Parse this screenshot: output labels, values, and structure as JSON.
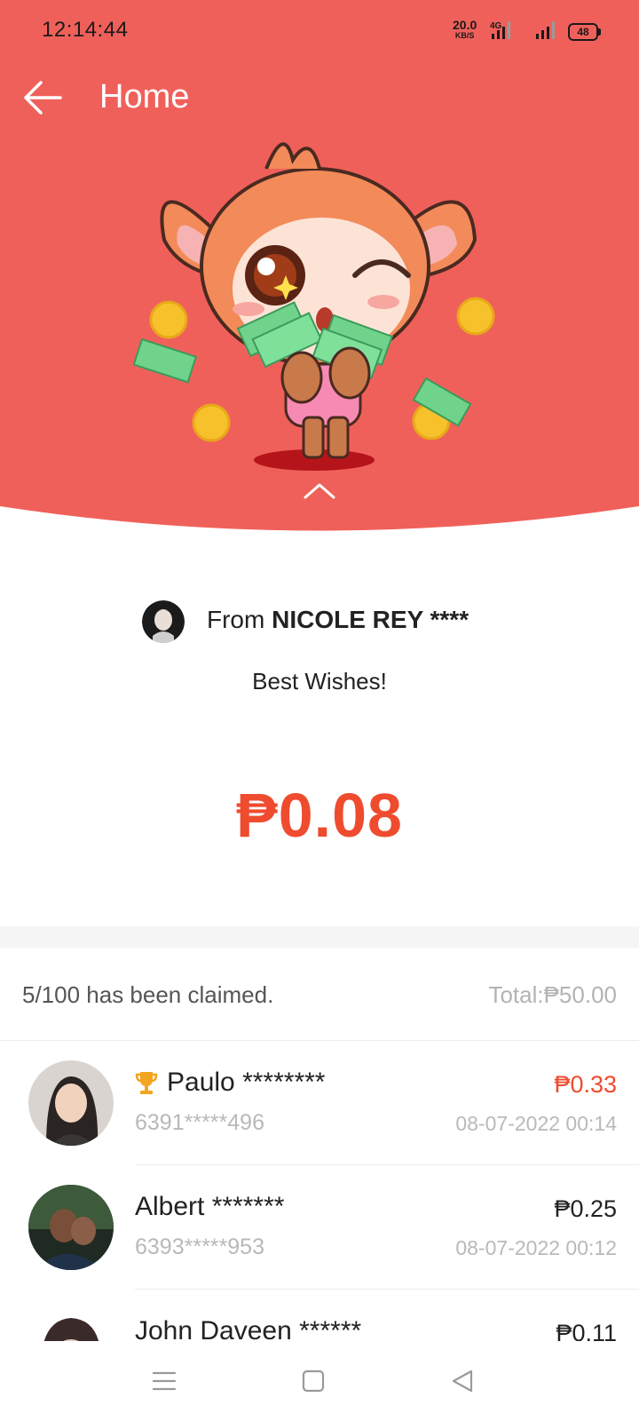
{
  "status_bar": {
    "time": "12:14:44",
    "net_speed_value": "20.0",
    "net_speed_unit": "KB/S",
    "network_type": "4G",
    "battery": "48"
  },
  "nav": {
    "title": "Home"
  },
  "sender": {
    "from_prefix": "From",
    "name": "NICOLE REY ****",
    "message": "Best Wishes!"
  },
  "amount": "₱0.08",
  "claim": {
    "status": "5/100 has been claimed.",
    "total": "Total:₱50.00"
  },
  "claims_list": [
    {
      "name": "Paulo ********",
      "phone": "6391*****496",
      "amount": "₱0.33",
      "date": "08-07-2022 00:14",
      "top": true
    },
    {
      "name": "Albert *******",
      "phone": "6393*****953",
      "amount": "₱0.25",
      "date": "08-07-2022 00:12",
      "top": false
    },
    {
      "name": "John Daveen ******",
      "phone": "",
      "amount": "₱0.11",
      "date": "",
      "top": false
    }
  ],
  "colors": {
    "header_red": "#f0605a",
    "amount_red": "#ef4b2f",
    "trophy_gold": "#f2a51e"
  },
  "icons": [
    "back-arrow-icon",
    "chevron-up-icon",
    "trophy-icon",
    "menu-icon",
    "home-square-icon",
    "back-triangle-icon"
  ]
}
